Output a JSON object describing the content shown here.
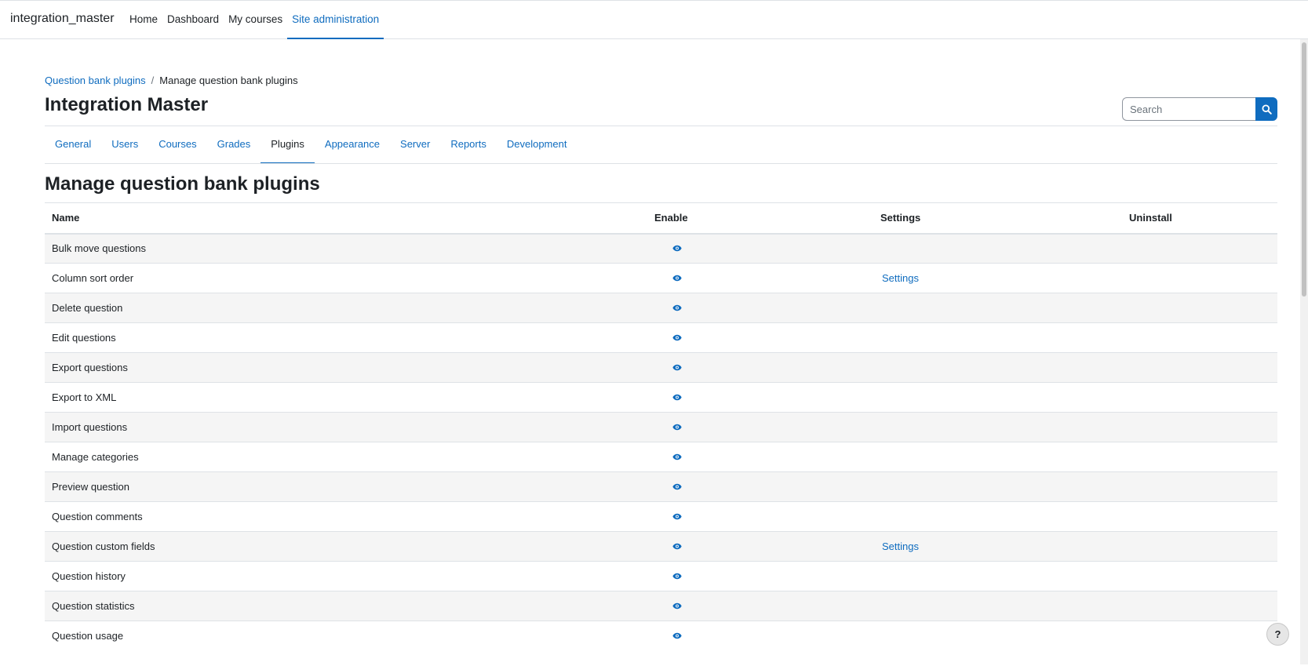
{
  "navbar": {
    "brand": "integration_master",
    "links": [
      {
        "label": "Home",
        "active": false
      },
      {
        "label": "Dashboard",
        "active": false
      },
      {
        "label": "My courses",
        "active": false
      },
      {
        "label": "Site administration",
        "active": true
      }
    ]
  },
  "breadcrumb": {
    "link": "Question bank plugins",
    "separator": "/",
    "current": "Manage question bank plugins"
  },
  "site_title": "Integration Master",
  "search": {
    "placeholder": "Search",
    "value": "",
    "icon": "search-icon"
  },
  "tabs": [
    {
      "label": "General",
      "active": false
    },
    {
      "label": "Users",
      "active": false
    },
    {
      "label": "Courses",
      "active": false
    },
    {
      "label": "Grades",
      "active": false
    },
    {
      "label": "Plugins",
      "active": true
    },
    {
      "label": "Appearance",
      "active": false
    },
    {
      "label": "Server",
      "active": false
    },
    {
      "label": "Reports",
      "active": false
    },
    {
      "label": "Development",
      "active": false
    }
  ],
  "page_heading": "Manage question bank plugins",
  "table": {
    "headers": {
      "name": "Name",
      "enable": "Enable",
      "settings": "Settings",
      "uninstall": "Uninstall"
    },
    "rows": [
      {
        "name": "Bulk move questions",
        "enabled_icon": "eye-icon",
        "settings": ""
      },
      {
        "name": "Column sort order",
        "enabled_icon": "eye-icon",
        "settings": "Settings"
      },
      {
        "name": "Delete question",
        "enabled_icon": "eye-icon",
        "settings": ""
      },
      {
        "name": "Edit questions",
        "enabled_icon": "eye-icon",
        "settings": ""
      },
      {
        "name": "Export questions",
        "enabled_icon": "eye-icon",
        "settings": ""
      },
      {
        "name": "Export to XML",
        "enabled_icon": "eye-icon",
        "settings": ""
      },
      {
        "name": "Import questions",
        "enabled_icon": "eye-icon",
        "settings": ""
      },
      {
        "name": "Manage categories",
        "enabled_icon": "eye-icon",
        "settings": ""
      },
      {
        "name": "Preview question",
        "enabled_icon": "eye-icon",
        "settings": ""
      },
      {
        "name": "Question comments",
        "enabled_icon": "eye-icon",
        "settings": ""
      },
      {
        "name": "Question custom fields",
        "enabled_icon": "eye-icon",
        "settings": "Settings"
      },
      {
        "name": "Question history",
        "enabled_icon": "eye-icon",
        "settings": ""
      },
      {
        "name": "Question statistics",
        "enabled_icon": "eye-icon",
        "settings": ""
      },
      {
        "name": "Question usage",
        "enabled_icon": "eye-icon",
        "settings": ""
      }
    ]
  },
  "help_button": {
    "label": "?"
  },
  "colors": {
    "accent": "#0f6cbf",
    "text": "#1d2125",
    "stripe": "#f5f5f5",
    "border": "#dee2e6"
  }
}
